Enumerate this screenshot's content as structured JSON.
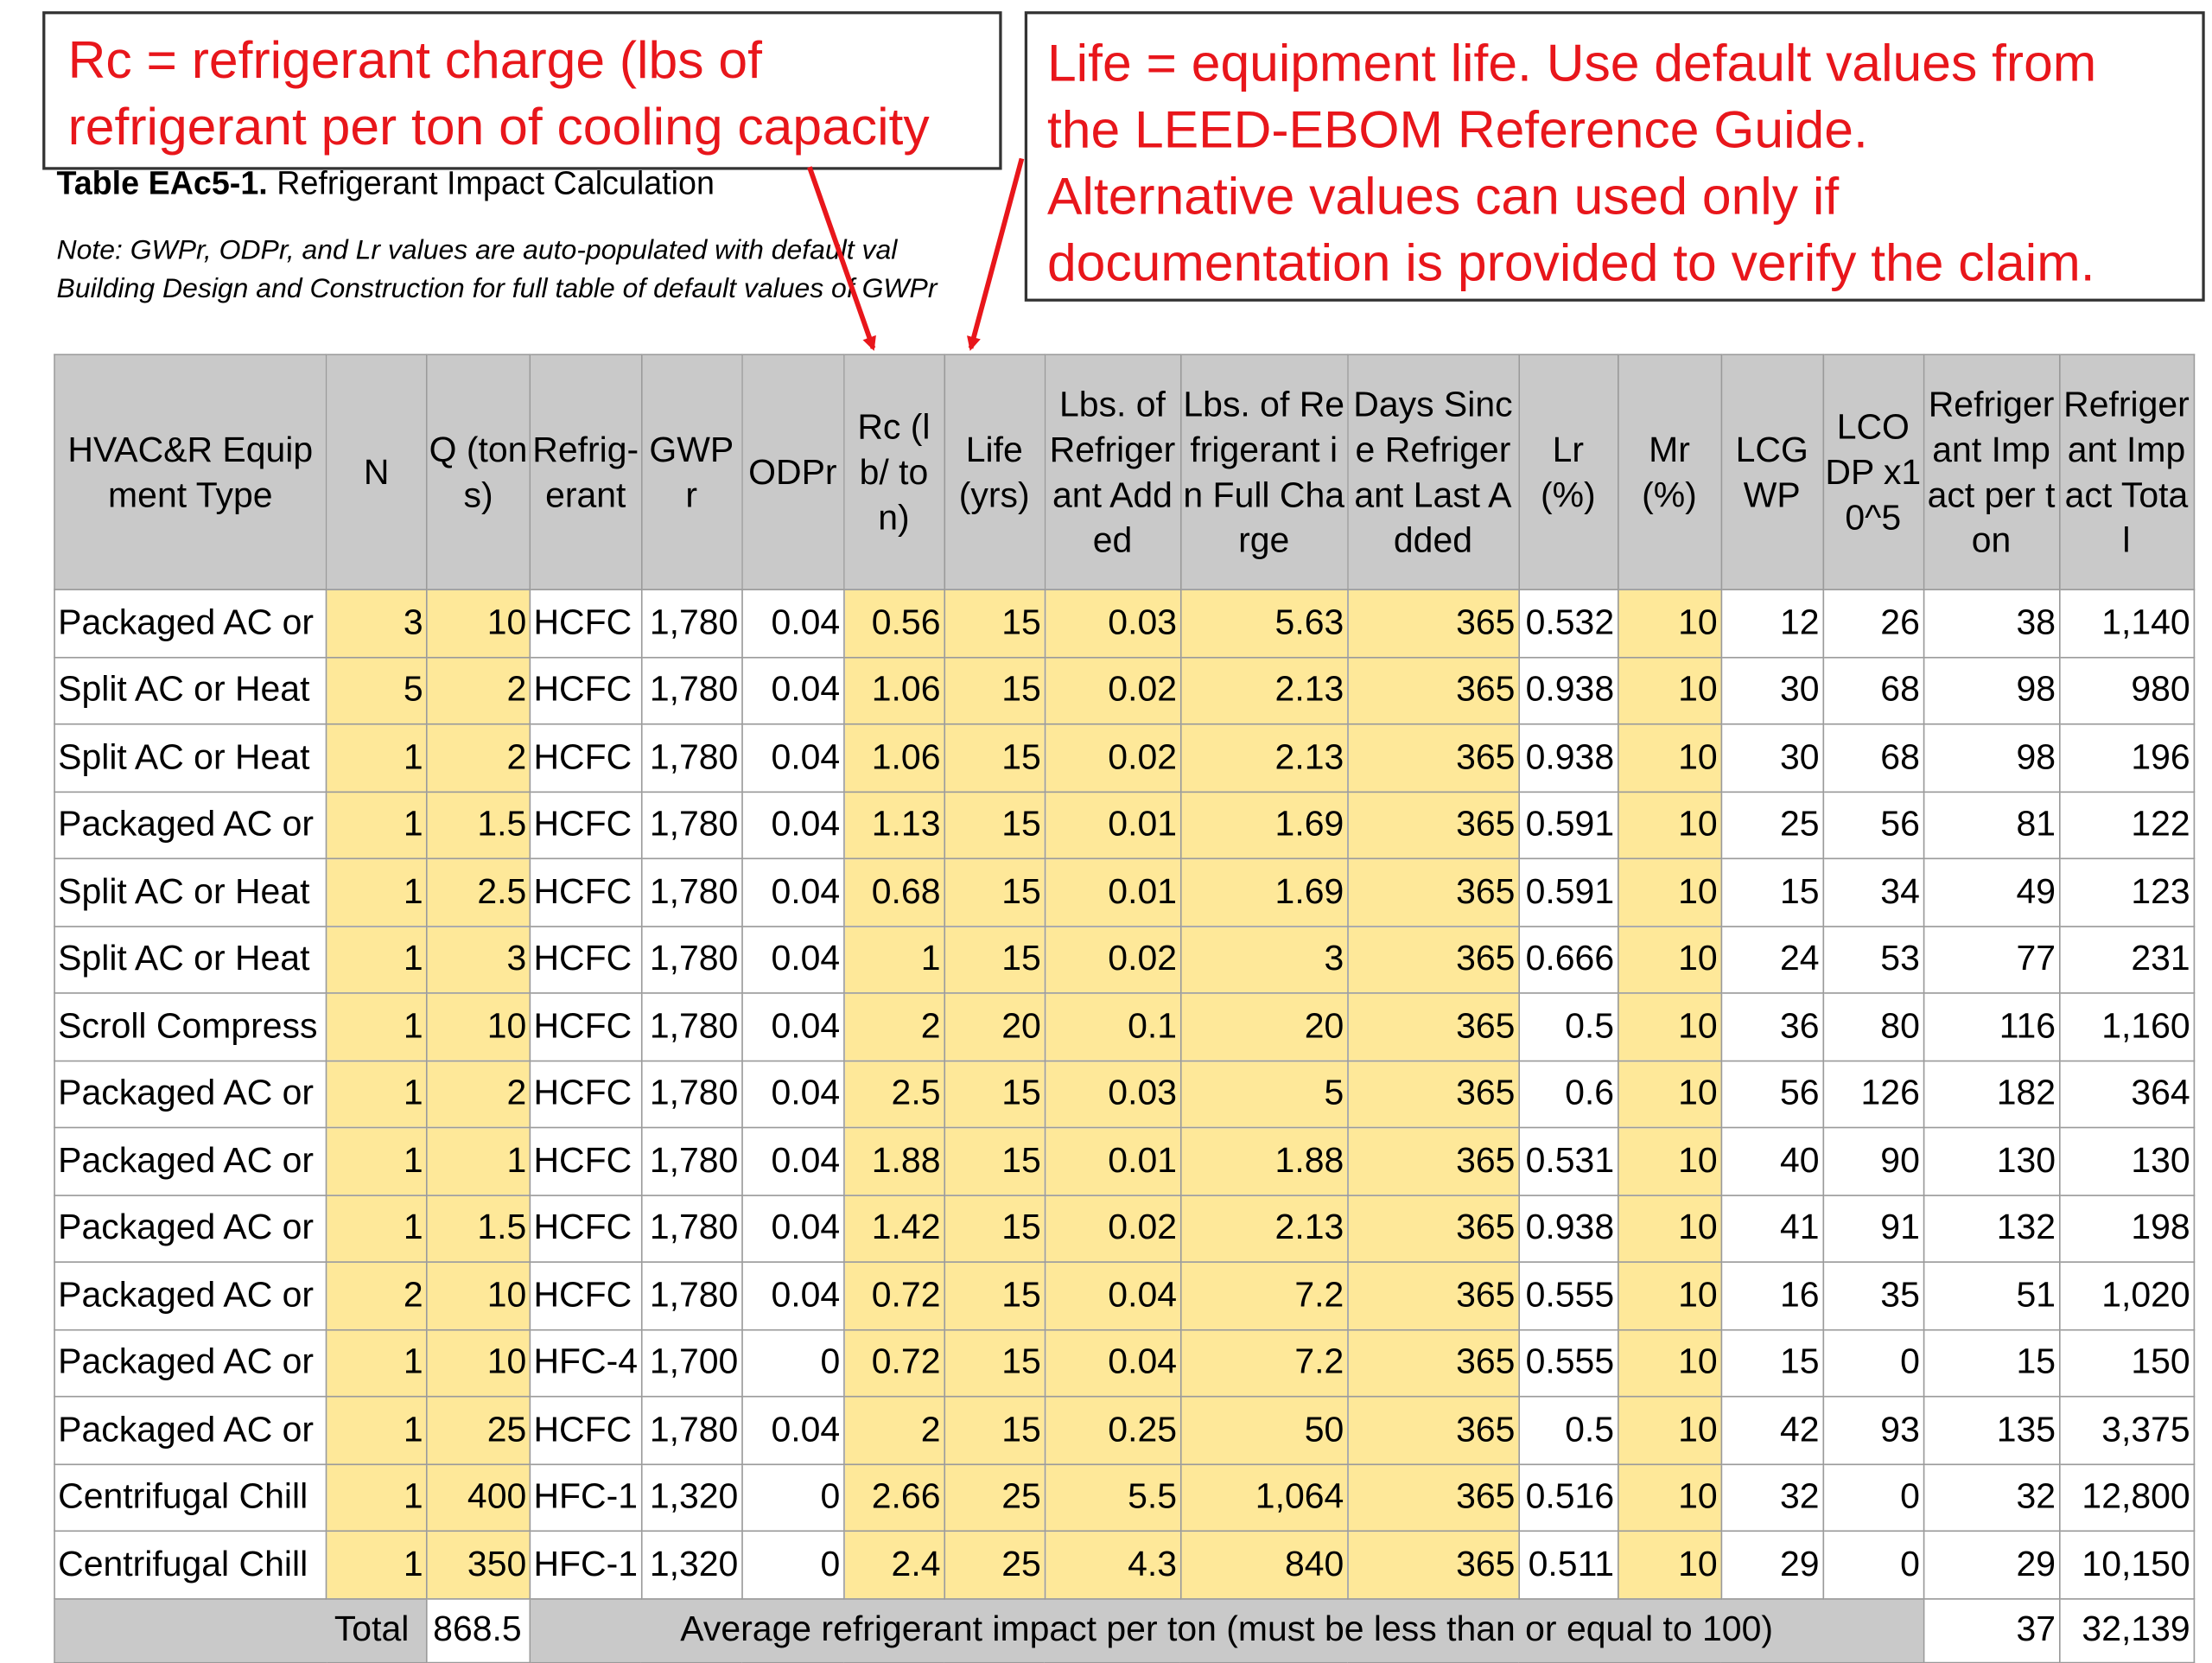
{
  "callouts": {
    "rc_lines": [
      "Rc = refrigerant charge (lbs of",
      "refrigerant per ton of cooling capacity"
    ],
    "life_lines": [
      "Life = equipment life. Use default values from",
      "the LEED-EBOM Reference Guide.",
      "Alternative values can used only if",
      "documentation is provided to verify the claim."
    ]
  },
  "caption": {
    "bold": "Table EAc5-1.",
    "text": " Refrigerant Impact Calculation"
  },
  "note_lines": [
    "Note: GWPr, ODPr, and Lr values are auto-populated with default val",
    "Building Design and Construction for full table of default values of GWPr"
  ],
  "table": {
    "headers": [
      "HVAC&R Equipment Type",
      "N",
      "Q (tons)",
      "Refrig-erant",
      "GWPr",
      "ODPr",
      "Rc (lb/ ton)",
      "Life (yrs)",
      "Lbs. of Refrigerant Added",
      "Lbs. of Refrigerant in Full Charge",
      "Days Since Refrigerant Last Added",
      "Lr (%)",
      "Mr (%)",
      "LCGWP",
      "LCODP x10^5",
      "Refrigerant Impact per ton",
      "Refrigerant Impact Total"
    ],
    "rows": [
      [
        "Packaged AC or",
        "3",
        "10",
        "HCFC",
        "1,780",
        "0.04",
        "0.56",
        "15",
        "0.03",
        "5.63",
        "365",
        "0.532",
        "10",
        "12",
        "26",
        "38",
        "1,140"
      ],
      [
        "Split AC or Heat",
        "5",
        "2",
        "HCFC",
        "1,780",
        "0.04",
        "1.06",
        "15",
        "0.02",
        "2.13",
        "365",
        "0.938",
        "10",
        "30",
        "68",
        "98",
        "980"
      ],
      [
        "Split AC or Heat",
        "1",
        "2",
        "HCFC",
        "1,780",
        "0.04",
        "1.06",
        "15",
        "0.02",
        "2.13",
        "365",
        "0.938",
        "10",
        "30",
        "68",
        "98",
        "196"
      ],
      [
        "Packaged AC or",
        "1",
        "1.5",
        "HCFC",
        "1,780",
        "0.04",
        "1.13",
        "15",
        "0.01",
        "1.69",
        "365",
        "0.591",
        "10",
        "25",
        "56",
        "81",
        "122"
      ],
      [
        "Split AC or Heat",
        "1",
        "2.5",
        "HCFC",
        "1,780",
        "0.04",
        "0.68",
        "15",
        "0.01",
        "1.69",
        "365",
        "0.591",
        "10",
        "15",
        "34",
        "49",
        "123"
      ],
      [
        "Split AC or Heat",
        "1",
        "3",
        "HCFC",
        "1,780",
        "0.04",
        "1",
        "15",
        "0.02",
        "3",
        "365",
        "0.666",
        "10",
        "24",
        "53",
        "77",
        "231"
      ],
      [
        "Scroll Compress",
        "1",
        "10",
        "HCFC",
        "1,780",
        "0.04",
        "2",
        "20",
        "0.1",
        "20",
        "365",
        "0.5",
        "10",
        "36",
        "80",
        "116",
        "1,160"
      ],
      [
        "Packaged AC or",
        "1",
        "2",
        "HCFC",
        "1,780",
        "0.04",
        "2.5",
        "15",
        "0.03",
        "5",
        "365",
        "0.6",
        "10",
        "56",
        "126",
        "182",
        "364"
      ],
      [
        "Packaged AC or",
        "1",
        "1",
        "HCFC",
        "1,780",
        "0.04",
        "1.88",
        "15",
        "0.01",
        "1.88",
        "365",
        "0.531",
        "10",
        "40",
        "90",
        "130",
        "130"
      ],
      [
        "Packaged AC or",
        "1",
        "1.5",
        "HCFC",
        "1,780",
        "0.04",
        "1.42",
        "15",
        "0.02",
        "2.13",
        "365",
        "0.938",
        "10",
        "41",
        "91",
        "132",
        "198"
      ],
      [
        "Packaged AC or",
        "2",
        "10",
        "HCFC",
        "1,780",
        "0.04",
        "0.72",
        "15",
        "0.04",
        "7.2",
        "365",
        "0.555",
        "10",
        "16",
        "35",
        "51",
        "1,020"
      ],
      [
        "Packaged AC or",
        "1",
        "10",
        "HFC-4",
        "1,700",
        "0",
        "0.72",
        "15",
        "0.04",
        "7.2",
        "365",
        "0.555",
        "10",
        "15",
        "0",
        "15",
        "150"
      ],
      [
        "Packaged AC or",
        "1",
        "25",
        "HCFC",
        "1,780",
        "0.04",
        "2",
        "15",
        "0.25",
        "50",
        "365",
        "0.5",
        "10",
        "42",
        "93",
        "135",
        "3,375"
      ],
      [
        "Centrifugal Chill",
        "1",
        "400",
        "HFC-1",
        "1,320",
        "0",
        "2.66",
        "25",
        "5.5",
        "1,064",
        "365",
        "0.516",
        "10",
        "32",
        "0",
        "32",
        "12,800"
      ],
      [
        "Centrifugal Chill",
        "1",
        "350",
        "HFC-1",
        "1,320",
        "0",
        "2.4",
        "25",
        "4.3",
        "840",
        "365",
        "0.511",
        "10",
        "29",
        "0",
        "29",
        "10,150"
      ]
    ],
    "footer": {
      "total_label": "Total",
      "total_value": "868.5",
      "avg_label": "Average refrigerant impact per ton (must be less than or equal to 100)",
      "avg_value": "37",
      "grand_total": "32,139"
    }
  },
  "colors": {
    "callout_text": "#e8161b",
    "input_cell": "#fee899",
    "header_bg": "#c9c9c9"
  }
}
